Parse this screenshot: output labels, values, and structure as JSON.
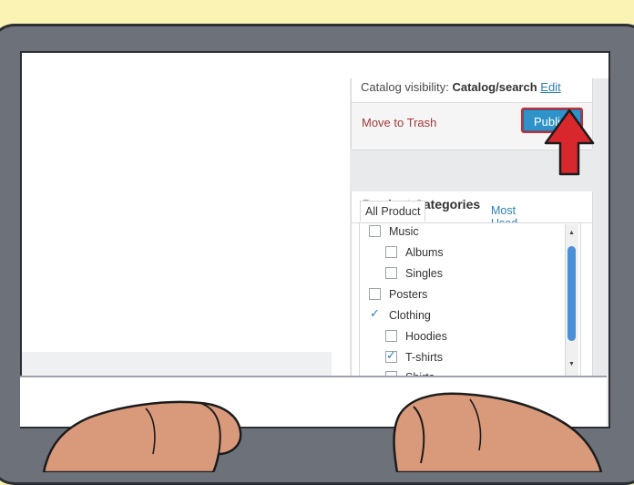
{
  "publish": {
    "visibility_label": "Catalog visibility:",
    "visibility_value": "Catalog/search",
    "edit_link": "Edit",
    "move_to_trash": "Move to Trash",
    "publish_button": "Publish"
  },
  "categories": {
    "title": "Product Categories",
    "tabs": [
      {
        "label": "All Product Categories",
        "active": true
      },
      {
        "label": "Most Used",
        "active": false
      }
    ],
    "items": [
      {
        "label": "Music",
        "checked": false,
        "indent": 0
      },
      {
        "label": "Albums",
        "checked": false,
        "indent": 1
      },
      {
        "label": "Singles",
        "checked": false,
        "indent": 1
      },
      {
        "label": "Posters",
        "checked": false,
        "indent": 0
      },
      {
        "label": "Clothing",
        "checked": true,
        "indent": 0
      },
      {
        "label": "Hoodies",
        "checked": false,
        "indent": 1
      },
      {
        "label": "T-shirts",
        "checked": true,
        "indent": 1
      },
      {
        "label": "Shirts",
        "checked": false,
        "indent": 1
      }
    ]
  },
  "icons": {
    "cursor": "red-arrow-cursor-icon",
    "check": "checkmark-icon",
    "scroll_up": "scroll-up-arrow-icon",
    "scroll_down": "scroll-down-arrow-icon"
  },
  "colors": {
    "background": "#fbf3b4",
    "laptop_bezel": "#6d727a",
    "publish_button": "#2f93c9",
    "highlight_border": "#d9272e",
    "link": "#2a7fb8",
    "trash": "#a33a3a",
    "scroll_thumb": "#4a90d9",
    "hand_skin": "#d99a7c"
  }
}
